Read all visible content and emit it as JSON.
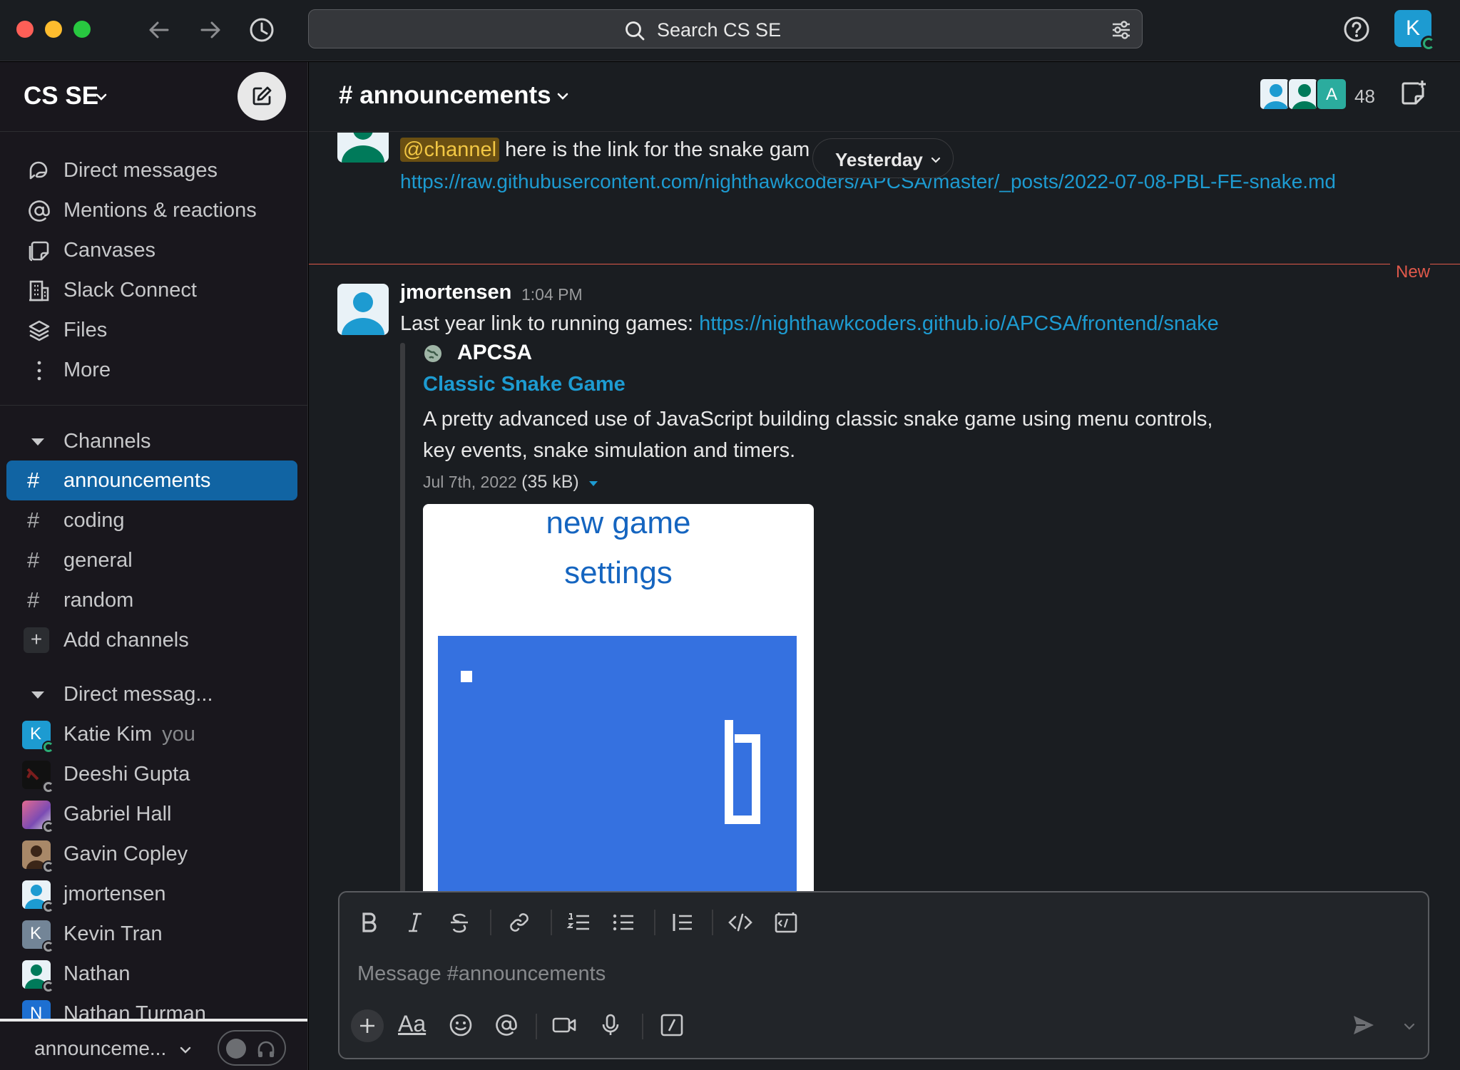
{
  "search": {
    "placeholder": "Search CS SE"
  },
  "user": {
    "avatar_initial": "K"
  },
  "workspace": {
    "name": "CS SE"
  },
  "nav": [
    {
      "label": "Direct messages",
      "icon": "dm-icon"
    },
    {
      "label": "Mentions & reactions",
      "icon": "at-icon"
    },
    {
      "label": "Canvases",
      "icon": "canvas-icon"
    },
    {
      "label": "Slack Connect",
      "icon": "building-icon"
    },
    {
      "label": "Files",
      "icon": "layers-icon"
    },
    {
      "label": "More",
      "icon": "more-vertical-icon"
    }
  ],
  "channels": {
    "header": "Channels",
    "items": [
      {
        "name": "announcements",
        "active": true
      },
      {
        "name": "coding"
      },
      {
        "name": "general"
      },
      {
        "name": "random"
      }
    ],
    "add_label": "Add channels"
  },
  "dms": {
    "header": "Direct messag...",
    "items": [
      {
        "name": "Katie Kim",
        "suffix": "you",
        "initial": "K"
      },
      {
        "name": "Deeshi Gupta"
      },
      {
        "name": "Gabriel Hall"
      },
      {
        "name": "Gavin Copley"
      },
      {
        "name": "jmortensen"
      },
      {
        "name": "Kevin Tran",
        "initial": "K"
      },
      {
        "name": "Nathan"
      },
      {
        "name": "Nathan Turman",
        "initial": "N"
      }
    ]
  },
  "sidebar_footer": {
    "label": "announceme..."
  },
  "channel_header": {
    "title": "# announcements",
    "member_count": "48",
    "member_initial": "A"
  },
  "messages": {
    "prev": {
      "mention": "@channel",
      "text": " here is the link for the snake gam",
      "link": "https://raw.githubusercontent.com/nighthawkcoders/APCSA/master/_posts/2022-07-08-PBL-FE-snake.md"
    },
    "date_divider": "Yesterday",
    "new_label": "New",
    "current": {
      "author": "jmortensen",
      "time": "1:04 PM",
      "text": "Last year link to running games: ",
      "link": "https://nighthawkcoders.github.io/APCSA/frontend/snake",
      "unfurl": {
        "site": "APCSA",
        "title": "Classic Snake Game",
        "description": "A pretty advanced use of JavaScript building classic snake game using menu controls, key events, snake simulation and timers.",
        "date": "Jul 7th, 2022",
        "size": "(35 kB)",
        "preview": {
          "line1": "new game",
          "line2": "settings"
        }
      }
    }
  },
  "composer": {
    "placeholder": "Message #announcements",
    "format_label": "Aa"
  },
  "colors": {
    "accent": "#1164a3",
    "link": "#1d9bd1",
    "new_line": "#e0594b",
    "mention_text": "#f2c744"
  }
}
